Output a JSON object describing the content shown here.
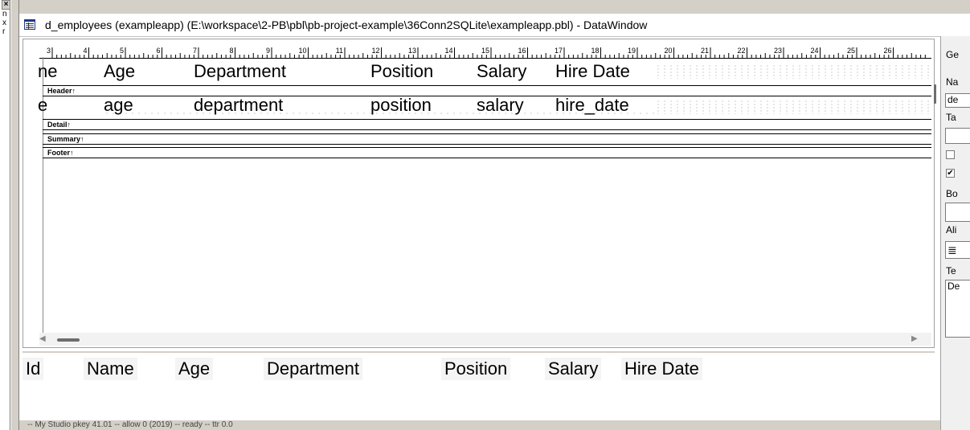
{
  "left_panel": {
    "close_glyph": "×",
    "items": [
      "n",
      "x",
      "r"
    ]
  },
  "window": {
    "title": "d_employees  (exampleapp) (E:\\workspace\\2-PB\\pbl\\pb-project-example\\36Conn2SQLite\\exampleapp.pbl) - DataWindow"
  },
  "ruler": {
    "labels": [
      "3",
      "4",
      "5",
      "6",
      "7",
      "8",
      "9",
      "10",
      "11",
      "12",
      "13",
      "14",
      "15",
      "16",
      "17",
      "18",
      "19",
      "20",
      "21",
      "22",
      "23",
      "24",
      "25",
      "26"
    ]
  },
  "header_band": {
    "columns": [
      "ne",
      "Age",
      "Department",
      "Position",
      "Salary",
      "Hire Date"
    ],
    "label": "Header↑"
  },
  "detail_band": {
    "columns": [
      "e",
      "age",
      "department",
      "position",
      "salary",
      "hire_date"
    ],
    "label": "Detail↑"
  },
  "summary_band": {
    "label": "Summary↑"
  },
  "footer_band": {
    "label": "Footer↑"
  },
  "preview": {
    "columns": [
      "Id",
      "Name",
      "Age",
      "Department",
      "Position",
      "Salary",
      "Hire Date"
    ]
  },
  "status_bar": {
    "text": "-- My Studio  pkey 41.01 -- allow 0 (2019)  -- ready  --  ttr 0.0"
  },
  "properties_panel": {
    "tab_label": "Ge",
    "name_label": "Na",
    "name_value": "de",
    "tag_label": "Ta",
    "border_label": "Bo",
    "alignment_label": "Ali",
    "alignment_value": "≣",
    "text_label": "Te",
    "text_value": "De",
    "checkbox1_checked": false,
    "checkbox2_checked": true
  }
}
